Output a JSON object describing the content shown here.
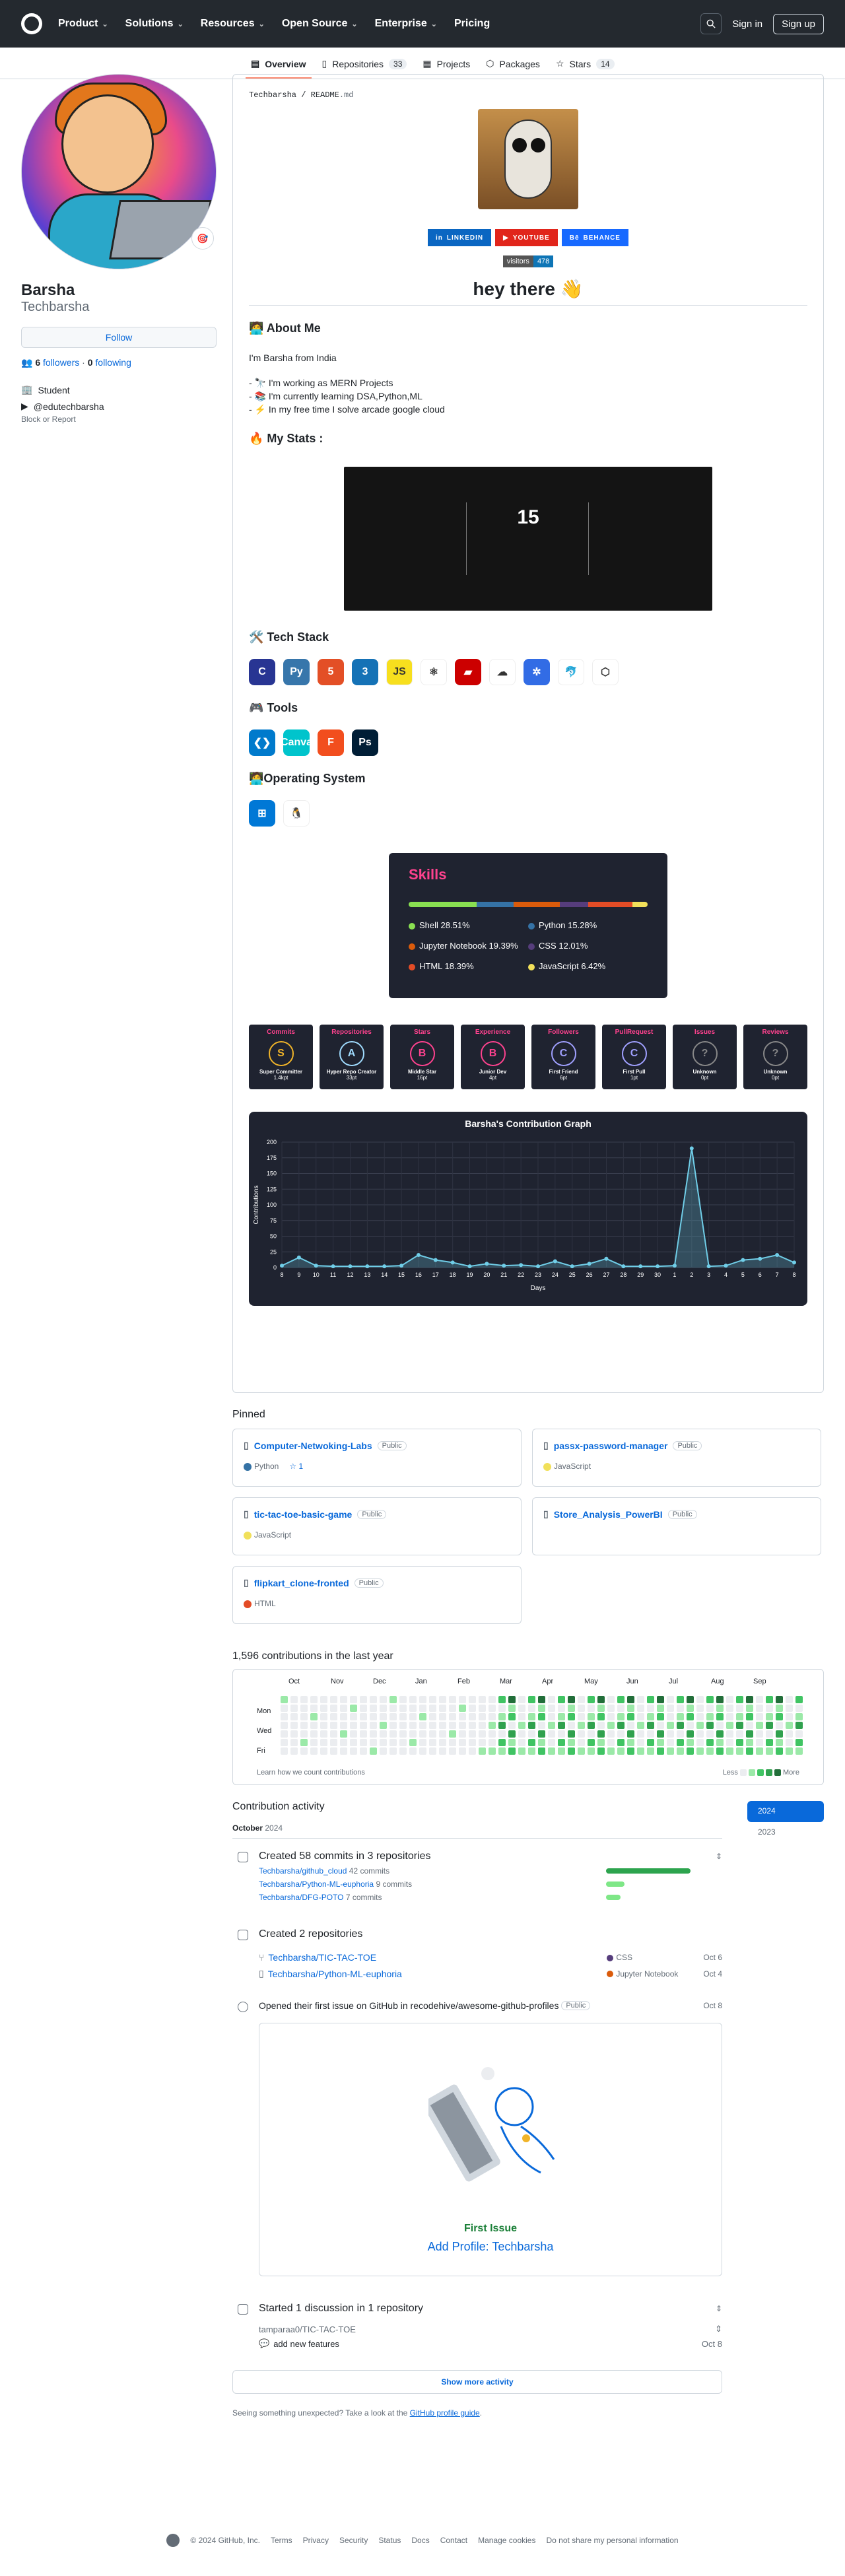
{
  "header": {
    "nav": [
      "Product",
      "Solutions",
      "Resources",
      "Open Source",
      "Enterprise",
      "Pricing"
    ],
    "signin": "Sign in",
    "signup": "Sign up"
  },
  "tabs": [
    {
      "label": "Overview"
    },
    {
      "label": "Repositories",
      "count": "33"
    },
    {
      "label": "Projects"
    },
    {
      "label": "Packages"
    },
    {
      "label": "Stars",
      "count": "14"
    }
  ],
  "profile": {
    "name": "Barsha",
    "login": "Techbarsha",
    "follow": "Follow",
    "followers_count": "6",
    "followers_label": "followers",
    "sep": "·",
    "following_count": "0",
    "following_label": "following",
    "occupation": "Student",
    "youtube": "@edutechbarsha",
    "block": "Block or Report"
  },
  "readme": {
    "path_user": "Techbarsha",
    "path_sep": " / ",
    "path_file": "README",
    "path_ext": ".md",
    "badges": [
      {
        "label": "LINKEDIN",
        "color": "#0a66c2"
      },
      {
        "label": "YOUTUBE",
        "color": "#e1251b"
      },
      {
        "label": "BEHANCE",
        "color": "#1769ff"
      }
    ],
    "visitors_label": "visitors",
    "visitors_count": "478",
    "greeting": "hey there 👋",
    "about_heading": "🧑‍💻 About Me",
    "about_text": "I'm Barsha from India",
    "about_items": [
      "- 🔭 I'm working as MERN Projects",
      "- 📚 I'm currently learning DSA,Python,ML",
      "- ⚡ In my free time I solve arcade google cloud"
    ],
    "stats_heading": "🔥 My Stats :",
    "stats_value": "15",
    "tech_heading": "🛠️ Tech Stack",
    "tech_icons": [
      {
        "name": "c-icon",
        "glyph": "C",
        "bg": "#283593"
      },
      {
        "name": "python-icon",
        "glyph": "Py",
        "bg": "#3776ab"
      },
      {
        "name": "html5-icon",
        "glyph": "5",
        "bg": "#e34f26"
      },
      {
        "name": "css3-icon",
        "glyph": "3",
        "bg": "#1572b6"
      },
      {
        "name": "javascript-icon",
        "glyph": "JS",
        "bg": "#f7df1e"
      },
      {
        "name": "react-icon",
        "glyph": "⚛",
        "bg": "#ffffff"
      },
      {
        "name": "rails-icon",
        "glyph": "▰",
        "bg": "#cc0000"
      },
      {
        "name": "google-cloud-icon",
        "glyph": "☁",
        "bg": "#ffffff"
      },
      {
        "name": "kubernetes-icon",
        "glyph": "✲",
        "bg": "#326ce5"
      },
      {
        "name": "mysql-icon",
        "glyph": "🐬",
        "bg": "#ffffff"
      },
      {
        "name": "box-icon",
        "glyph": "⬡",
        "bg": "#ffffff"
      }
    ],
    "tools_heading": "🎮 Tools",
    "tool_icons": [
      {
        "name": "vscode-icon",
        "glyph": "❮❯",
        "bg": "#007acc"
      },
      {
        "name": "canva-icon",
        "glyph": "Canva",
        "bg": "#00c4cc"
      },
      {
        "name": "figma-icon",
        "glyph": "F",
        "bg": "#f24e1e"
      },
      {
        "name": "photoshop-icon",
        "glyph": "Ps",
        "bg": "#001e36"
      }
    ],
    "os_heading": "🧑‍💻Operating System",
    "os_icons": [
      {
        "name": "windows-icon",
        "glyph": "⊞",
        "bg": "#0078d6"
      },
      {
        "name": "linux-icon",
        "glyph": "🐧",
        "bg": "#ffffff"
      }
    ],
    "skills": {
      "title": "Skills",
      "langs": [
        {
          "name": "Shell",
          "pct": "28.51%",
          "value": 28.51,
          "color": "#89e051"
        },
        {
          "name": "Python",
          "pct": "15.28%",
          "value": 15.28,
          "color": "#3572a5"
        },
        {
          "name": "Jupyter Notebook",
          "pct": "19.39%",
          "value": 19.39,
          "color": "#da5b0b"
        },
        {
          "name": "CSS",
          "pct": "12.01%",
          "value": 12.01,
          "color": "#563d7c"
        },
        {
          "name": "HTML",
          "pct": "18.39%",
          "value": 18.39,
          "color": "#e34c26"
        },
        {
          "name": "JavaScript",
          "pct": "6.42%",
          "value": 6.42,
          "color": "#f1e05a"
        }
      ]
    },
    "trophies": [
      {
        "title": "Commits",
        "rank": "S",
        "desc": "Super Committer",
        "sub": "1.4kpt",
        "color": "#f0b429"
      },
      {
        "title": "Repositories",
        "rank": "A",
        "desc": "Hyper Repo Creator",
        "sub": "33pt",
        "color": "#a0dcff"
      },
      {
        "title": "Stars",
        "rank": "B",
        "desc": "Middle Star",
        "sub": "16pt",
        "color": "#fe428e"
      },
      {
        "title": "Experience",
        "rank": "B",
        "desc": "Junior Dev",
        "sub": "4pt",
        "color": "#fe428e"
      },
      {
        "title": "Followers",
        "rank": "C",
        "desc": "First Friend",
        "sub": "6pt",
        "color": "#a0a0ff"
      },
      {
        "title": "PullRequest",
        "rank": "C",
        "desc": "First Pull",
        "sub": "1pt",
        "color": "#a0a0ff"
      },
      {
        "title": "Issues",
        "rank": "?",
        "desc": "Unknown",
        "sub": "0pt",
        "color": "#888"
      },
      {
        "title": "Reviews",
        "rank": "?",
        "desc": "Unknown",
        "sub": "0pt",
        "color": "#888"
      }
    ]
  },
  "chart_data": {
    "type": "area",
    "title": "Barsha's Contribution Graph",
    "xlabel": "Days",
    "ylabel": "Contributions",
    "x": [
      "8",
      "9",
      "10",
      "11",
      "12",
      "13",
      "14",
      "15",
      "16",
      "17",
      "18",
      "19",
      "20",
      "21",
      "22",
      "23",
      "24",
      "25",
      "26",
      "27",
      "28",
      "29",
      "30",
      "1",
      "2",
      "3",
      "4",
      "5",
      "6",
      "7",
      "8"
    ],
    "series": [
      {
        "values": [
          3,
          16,
          3,
          2,
          2,
          2,
          2,
          3,
          20,
          12,
          8,
          2,
          6,
          3,
          4,
          2,
          10,
          2,
          6,
          14,
          2,
          2,
          2,
          3,
          190,
          2,
          3,
          12,
          14,
          20,
          8
        ]
      }
    ],
    "ylim": [
      0,
      200
    ],
    "yticks": [
      0,
      25,
      50,
      75,
      100,
      125,
      150,
      175,
      200
    ],
    "grid": true
  },
  "pinned": {
    "title": "Pinned",
    "items": [
      {
        "name": "Computer-Netwoking-Labs",
        "badge": "Public",
        "lang": "Python",
        "lang_color": "#3572a5",
        "stars": "1"
      },
      {
        "name": "passx-password-manager",
        "badge": "Public",
        "lang": "JavaScript",
        "lang_color": "#f1e05a",
        "stars": ""
      },
      {
        "name": "tic-tac-toe-basic-game",
        "badge": "Public",
        "lang": "JavaScript",
        "lang_color": "#f1e05a",
        "stars": ""
      },
      {
        "name": "Store_Analysis_PowerBI",
        "badge": "Public",
        "lang": "",
        "lang_color": "",
        "stars": ""
      },
      {
        "name": "flipkart_clone-fronted",
        "badge": "Public",
        "lang": "HTML",
        "lang_color": "#e34c26",
        "stars": ""
      }
    ]
  },
  "calendar": {
    "title": "1,596 contributions in the last year",
    "months": [
      "Oct",
      "Nov",
      "Dec",
      "Jan",
      "Feb",
      "Mar",
      "Apr",
      "May",
      "Jun",
      "Jul",
      "Aug",
      "Sep"
    ],
    "days": [
      "Mon",
      "Wed",
      "Fri"
    ],
    "learn": "Learn how we count contributions",
    "less": "Less",
    "more": "More",
    "colors": [
      "#ebedf0",
      "#9be9a8",
      "#40c463",
      "#30a14e",
      "#216e39"
    ]
  },
  "activity": {
    "title": "Contribution activity",
    "years": [
      "2024",
      "2023"
    ],
    "month": "October",
    "month_year": "2024",
    "commits_head": "Created 58 commits in 3 repositories",
    "commit_repos": [
      {
        "repo": "Techbarsha/github_cloud",
        "count": "42 commits",
        "bar": 42
      },
      {
        "repo": "Techbarsha/Python-ML-euphoria",
        "count": "9 commits",
        "bar": 9
      },
      {
        "repo": "Techbarsha/DFG-POTO",
        "count": "7 commits",
        "bar": 7
      }
    ],
    "repos_head": "Created 2 repositories",
    "created_repos": [
      {
        "repo": "Techbarsha/TIC-TAC-TOE",
        "lang": "CSS",
        "lang_color": "#563d7c",
        "date": "Oct 6"
      },
      {
        "repo": "Techbarsha/Python-ML-euphoria",
        "lang": "Jupyter Notebook",
        "lang_color": "#da5b0b",
        "date": "Oct 4"
      }
    ],
    "issue_head": "Opened their first issue on GitHub in recodehive/awesome-github-profiles",
    "issue_badge": "Public",
    "issue_date": "Oct 8",
    "first_issue": "First Issue",
    "issue_title": "Add Profile: Techbarsha",
    "discussion_head": "Started 1 discussion in 1 repository",
    "discussion_repo": "tamparaa0/TIC-TAC-TOE",
    "discussion_item": "add new features",
    "discussion_date": "Oct 8",
    "show_more": "Show more activity",
    "unexpected": "Seeing something unexpected? Take a look at the",
    "guide": "GitHub profile guide",
    "period": "."
  },
  "footer": {
    "copyright": "© 2024 GitHub, Inc.",
    "links": [
      "Terms",
      "Privacy",
      "Security",
      "Status",
      "Docs",
      "Contact",
      "Manage cookies",
      "Do not share my personal information"
    ]
  }
}
